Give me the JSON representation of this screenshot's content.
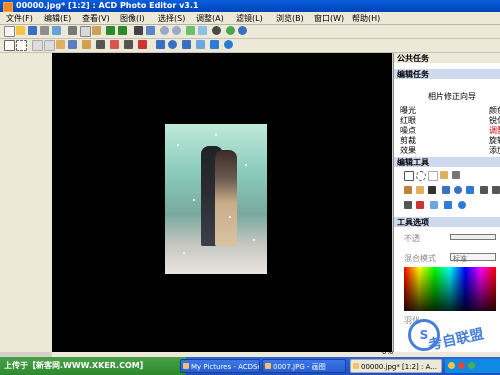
{
  "window": {
    "title": "00000.jpg* [1:2] : ACD Photo Editor v3.1"
  },
  "menu": [
    "文件(F)",
    "编辑(E)",
    "查看(V)",
    "图像(I)",
    "选择(S)",
    "调整(A)",
    "滤镜(L)",
    "浏览(B)",
    "窗口(W)",
    "帮助(H)"
  ],
  "icons": {
    "app": "acd-photo-editor-icon",
    "toolbar1": [
      "new",
      "open",
      "save",
      "print",
      "scan",
      "cut",
      "copy",
      "paste",
      "undo",
      "redo",
      "crop",
      "rotate",
      "zoom-in",
      "zoom-out",
      "fit",
      "actual",
      "adjust",
      "filter",
      "help"
    ],
    "toolbar2": [
      "select",
      "lasso",
      "magic-wand",
      "brush",
      "pencil",
      "eraser",
      "line",
      "rectangle",
      "ellipse",
      "text",
      "fill",
      "dropper",
      "clone",
      "sharpen",
      "blur"
    ]
  },
  "right_panel": {
    "title": "公共任务",
    "edit_tasks": {
      "header": "编辑任务",
      "wizard": "相片修正向导",
      "col1": [
        "曝光",
        "红眼",
        "噪点",
        "剪裁",
        "效果"
      ],
      "col2": [
        "颜色",
        "锐化",
        "调整",
        "旋转",
        "添加"
      ]
    },
    "edit_tools": {
      "header": "编辑工具"
    },
    "tool_options": {
      "header": "工具选项",
      "opacity_label": "不透",
      "blend_label": "混合模式",
      "blend_value": "标准",
      "bottom_label": "羽化"
    }
  },
  "taskbar": {
    "start": "上传于【新客网.WWW.XKER.COM】",
    "items": [
      "My Pictures - ACDSe...",
      "0007.JPG - 画图",
      "00000.jpg* [1:2] : A..."
    ],
    "status_zoom": "0%"
  },
  "watermark": {
    "letter": "S",
    "text": "考自联盟"
  },
  "colors": {
    "title_blue": "#0a5fdc",
    "canvas": "#000000",
    "link_red": "#c00000",
    "taskbar_blue": "#2457d0"
  }
}
